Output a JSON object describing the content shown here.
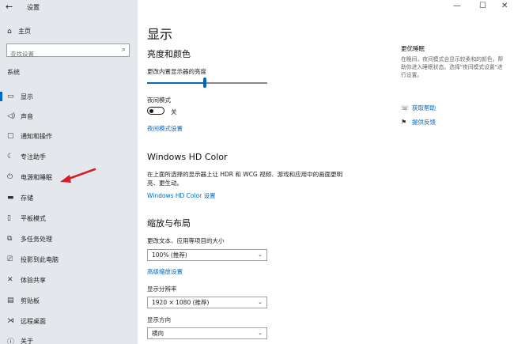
{
  "app": {
    "title": "设置",
    "back_icon": "back-arrow-icon"
  },
  "window_controls": {
    "minimize": "—",
    "maximize": "☐",
    "close": "✕"
  },
  "sidebar": {
    "home_label": "主页",
    "search_placeholder": "查找设置",
    "section_label": "系统",
    "items": [
      {
        "label": "显示",
        "icon": "display-icon",
        "active": true
      },
      {
        "label": "声音",
        "icon": "sound-icon"
      },
      {
        "label": "通知和操作",
        "icon": "notification-icon"
      },
      {
        "label": "专注助手",
        "icon": "focus-assist-icon"
      },
      {
        "label": "电源和睡眠",
        "icon": "power-icon"
      },
      {
        "label": "存储",
        "icon": "storage-icon"
      },
      {
        "label": "平板模式",
        "icon": "tablet-icon"
      },
      {
        "label": "多任务处理",
        "icon": "multitasking-icon"
      },
      {
        "label": "投影到此电脑",
        "icon": "projecting-icon"
      },
      {
        "label": "体验共享",
        "icon": "shared-experience-icon"
      },
      {
        "label": "剪贴板",
        "icon": "clipboard-icon"
      },
      {
        "label": "远程桌面",
        "icon": "remote-desktop-icon"
      },
      {
        "label": "关于",
        "icon": "about-icon"
      }
    ]
  },
  "main": {
    "title": "显示",
    "brightness": {
      "heading": "亮度和颜色",
      "slider_label": "更改内置显示器的亮度",
      "slider_value": 0.48
    },
    "night_light": {
      "label": "夜间模式",
      "state": "关",
      "settings_link": "夜间模式设置"
    },
    "hdr": {
      "heading": "Windows HD Color",
      "description": "在上面所选择的显示器上让 HDR 和 WCG 视频、游戏和应用中的画面更明亮、更生动。",
      "link": "Windows HD Color 设置"
    },
    "scale": {
      "heading": "缩放与布局",
      "scale_label": "更改文本、应用等项目的大小",
      "scale_value": "100% (推荐)",
      "advanced_link": "高级缩放设置",
      "resolution_label": "显示分辨率",
      "resolution_value": "1920 × 1080 (推荐)",
      "orientation_label": "显示方向",
      "orientation_value": "横向"
    }
  },
  "right_panel": {
    "title": "更优睡眠",
    "description": "在晚间，夜间模式会显示较柔和的颜色，帮助你进入睡眠状态。选择\"夜间模式设置\"进行设置。",
    "links": [
      {
        "label": "获取帮助",
        "icon": "help-icon"
      },
      {
        "label": "提供反馈",
        "icon": "feedback-icon"
      }
    ]
  },
  "colors": {
    "accent": "#0067c0",
    "sidebar_bg": "#e4e8ec",
    "annotation_arrow": "#d42027"
  }
}
